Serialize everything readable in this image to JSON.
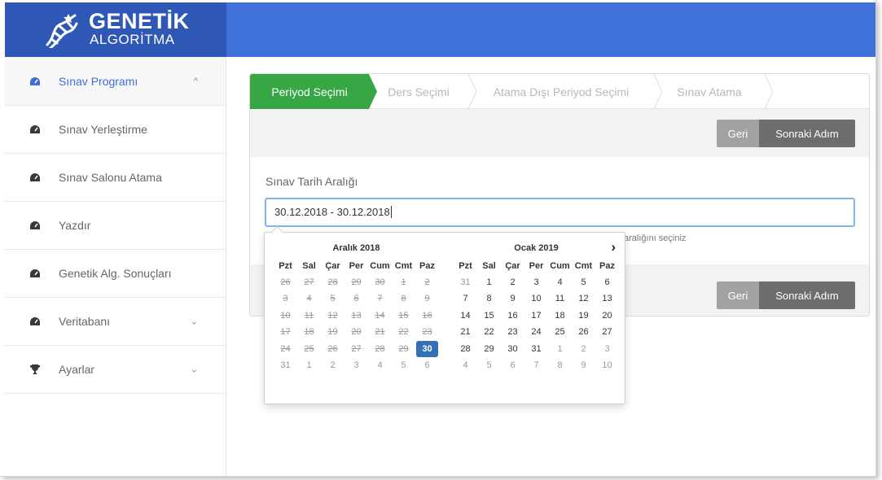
{
  "brand": {
    "line1": "GENETİK",
    "line2": "ALGORİTMA"
  },
  "colors": {
    "topbar": "#4071d9",
    "logo_bg": "#2f58b6",
    "step_active": "#36a744",
    "selected_day": "#3370b7",
    "input_focus": "#80b3f2"
  },
  "sidebar": {
    "items": [
      {
        "label": "Sınav Programı",
        "icon": "dashboard-icon",
        "chevron": "^"
      },
      {
        "label": "Sınav Yerleştirme",
        "icon": "dashboard-icon"
      },
      {
        "label": "Sınav Salonu Atama",
        "icon": "dashboard-icon"
      },
      {
        "label": "Yazdır",
        "icon": "dashboard-icon"
      },
      {
        "label": "Genetik Alg. Sonuçları",
        "icon": "dashboard-icon"
      },
      {
        "label": "Veritabanı",
        "icon": "dashboard-icon",
        "chevron": "⌄"
      },
      {
        "label": "Ayarlar",
        "icon": "trophy-icon",
        "chevron": "⌄"
      }
    ]
  },
  "wizard": {
    "steps": [
      "Periyod Seçimi",
      "Ders Seçimi",
      "Atama Dışı Periyod Seçimi",
      "Sınav Atama"
    ],
    "back_label": "Geri",
    "next_label": "Sonraki Adım"
  },
  "form": {
    "label": "Sınav Tarih Aralığı",
    "value": "30.12.2018 - 30.12.2018",
    "hint": "aralığını seçiniz"
  },
  "datepicker": {
    "weekdays": [
      "Pzt",
      "Sal",
      "Çar",
      "Per",
      "Cum",
      "Cmt",
      "Paz"
    ],
    "left": {
      "title": "Aralık 2018",
      "days": [
        "26",
        "27",
        "28",
        "29",
        "30",
        "1",
        "2",
        "3",
        "4",
        "5",
        "6",
        "7",
        "8",
        "9",
        "10",
        "11",
        "12",
        "13",
        "14",
        "15",
        "16",
        "17",
        "18",
        "19",
        "20",
        "21",
        "22",
        "23",
        "24",
        "25",
        "26",
        "27",
        "28",
        "29",
        "30",
        "31",
        "1",
        "2",
        "3",
        "4",
        "5",
        "6"
      ],
      "disabled_count": 34,
      "selected_index": 34
    },
    "right": {
      "title": "Ocak 2019",
      "next_arrow": "›",
      "days": [
        "31",
        "1",
        "2",
        "3",
        "4",
        "5",
        "6",
        "7",
        "8",
        "9",
        "10",
        "11",
        "12",
        "13",
        "14",
        "15",
        "16",
        "17",
        "18",
        "19",
        "20",
        "21",
        "22",
        "23",
        "24",
        "25",
        "26",
        "27",
        "28",
        "29",
        "30",
        "31",
        "1",
        "2",
        "3",
        "4",
        "5",
        "6",
        "7",
        "8",
        "9",
        "10"
      ],
      "leading_off": 1,
      "trailing_off_from": 31
    }
  }
}
